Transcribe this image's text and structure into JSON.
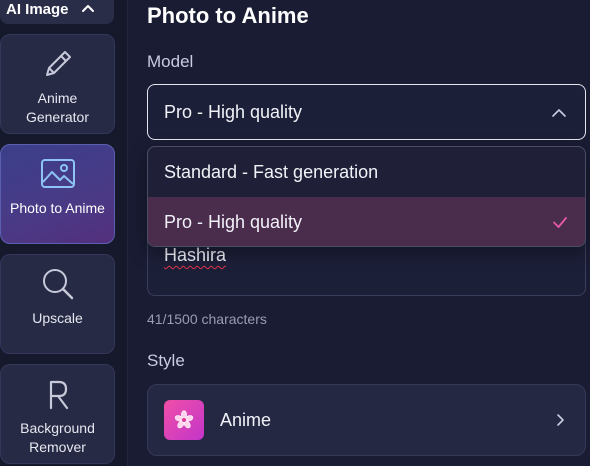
{
  "sidebar": {
    "header": "AI Image",
    "items": [
      {
        "label": "Anime Generator",
        "icon": "pencil-icon"
      },
      {
        "label": "Photo to Anime",
        "icon": "image-icon",
        "active": true
      },
      {
        "label": "Upscale",
        "icon": "magnifier-icon"
      },
      {
        "label": "Background Remover",
        "icon": "letter-r-icon"
      }
    ]
  },
  "main": {
    "title": "Photo to Anime",
    "model": {
      "label": "Model",
      "selected": "Pro - High quality",
      "options": [
        "Standard - Fast generation",
        "Pro - High quality"
      ]
    },
    "prompt": {
      "value": "Hashira",
      "counter": "41/1500 characters"
    },
    "style": {
      "label": "Style",
      "selected": "Anime"
    }
  },
  "colors": {
    "background": "#191c33",
    "selected_option": "#4a2c4d",
    "check": "#e85aa8",
    "active_tab": "#3b3f8a"
  }
}
